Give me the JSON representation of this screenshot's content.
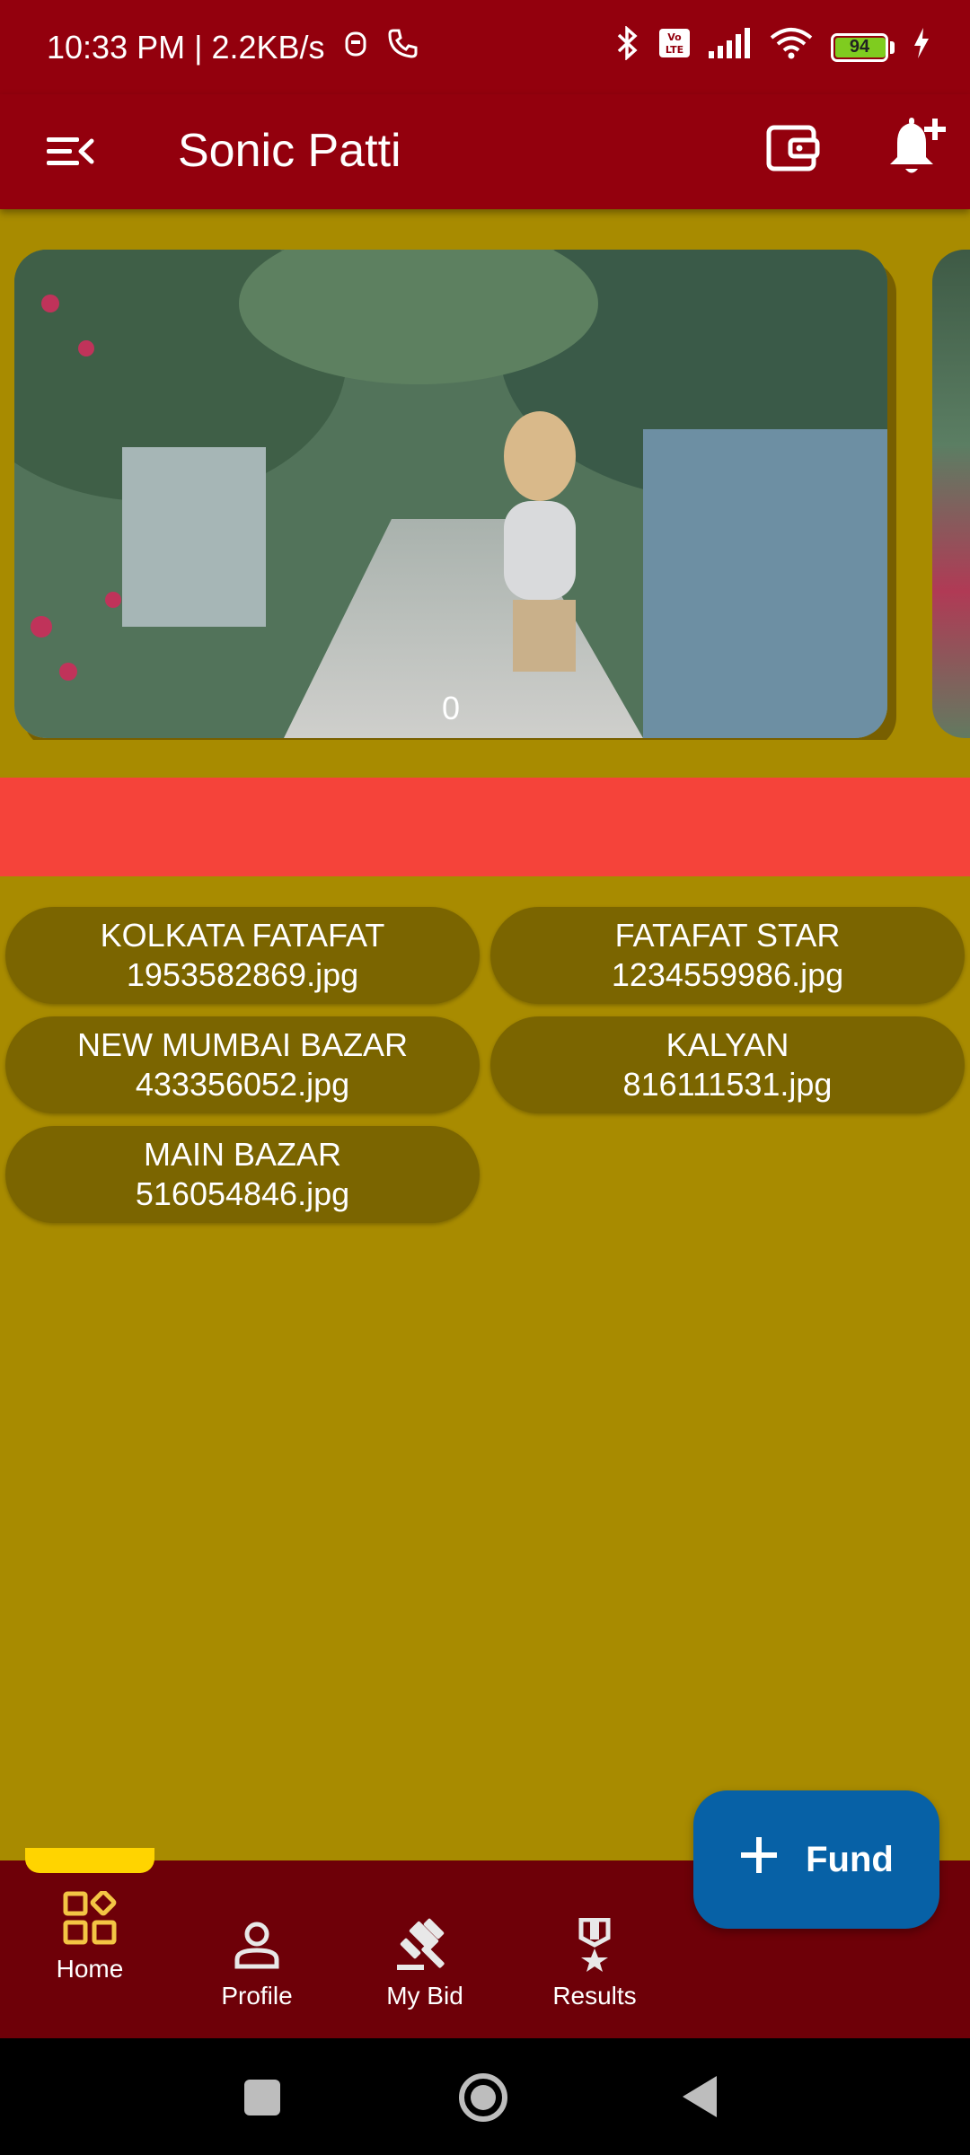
{
  "status_bar": {
    "time": "10:33 PM | 2.2KB/s",
    "battery": "94",
    "battery_level": 0.94
  },
  "app_bar": {
    "title": "Sonic Patti",
    "menu_icon": "menu-collapse-icon",
    "wallet_icon": "wallet-icon",
    "notification_icon": "bell-plus-icon"
  },
  "banner": {
    "counter": "0"
  },
  "markets": [
    {
      "name": "KOLKATA FATAFAT",
      "image": "1953582869.jpg"
    },
    {
      "name": "FATAFAT STAR",
      "image": "1234559986.jpg"
    },
    {
      "name": "NEW MUMBAI BAZAR",
      "image": "433356052.jpg"
    },
    {
      "name": "KALYAN",
      "image": "816111531.jpg"
    },
    {
      "name": "MAIN BAZAR",
      "image": "516054846.jpg"
    }
  ],
  "fab": {
    "label": "Fund",
    "icon": "plus-icon"
  },
  "bottom_nav": {
    "items": [
      {
        "label": "Home",
        "icon": "dashboard-icon",
        "active": true
      },
      {
        "label": "Profile",
        "icon": "person-icon"
      },
      {
        "label": "My Bid",
        "icon": "gavel-icon"
      },
      {
        "label": "Results",
        "icon": "medal-icon"
      }
    ]
  },
  "colors": {
    "app_bar": "#93000d",
    "background": "#a88b00",
    "market_pill": "#7b6500",
    "red_strip": "#f5433a",
    "fab": "#0761a6",
    "bottom_nav": "#6e0008",
    "nav_active": "#ffd400"
  }
}
